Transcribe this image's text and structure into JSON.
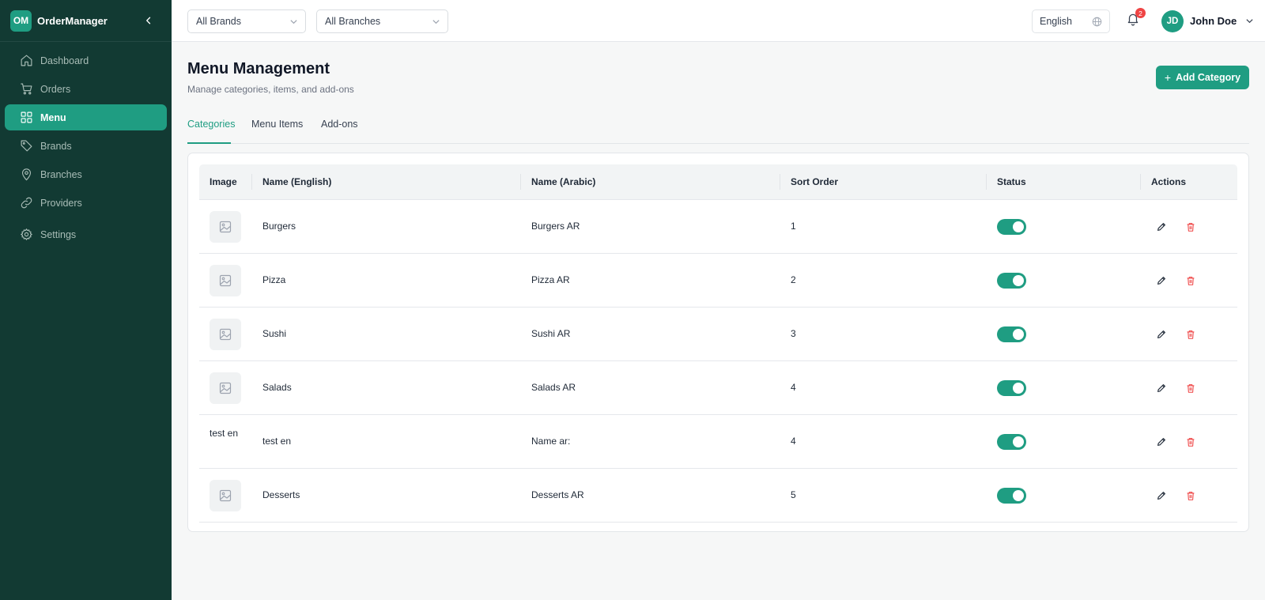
{
  "app": {
    "logo_initials": "OM",
    "name": "OrderManager"
  },
  "sidebar": {
    "items": [
      {
        "label": "Dashboard",
        "icon": "home-icon"
      },
      {
        "label": "Orders",
        "icon": "cart-icon"
      },
      {
        "label": "Menu",
        "icon": "grid-icon",
        "active": true
      },
      {
        "label": "Brands",
        "icon": "tag-icon"
      },
      {
        "label": "Branches",
        "icon": "map-pin-icon"
      },
      {
        "label": "Providers",
        "icon": "link-icon"
      },
      {
        "label": "Settings",
        "icon": "gear-icon"
      }
    ]
  },
  "topbar": {
    "brand_filter": "All Brands",
    "branch_filter": "All Branches",
    "language": "English",
    "notification_count": "2",
    "user_initials": "JD",
    "user_name": "John Doe"
  },
  "page": {
    "title": "Menu Management",
    "subtitle": "Manage categories, items, and add-ons",
    "add_button": "Add Category",
    "tabs": [
      {
        "label": "Categories",
        "active": true
      },
      {
        "label": "Menu Items"
      },
      {
        "label": "Add-ons"
      }
    ]
  },
  "table": {
    "headers": {
      "image": "Image",
      "name_en": "Name (English)",
      "name_ar": "Name (Arabic)",
      "sort": "Sort Order",
      "status": "Status",
      "actions": "Actions"
    },
    "rows": [
      {
        "name_en": "Burgers",
        "name_ar": "Burgers AR",
        "sort": "1",
        "status": true,
        "image": "placeholder"
      },
      {
        "name_en": "Pizza",
        "name_ar": "Pizza AR",
        "sort": "2",
        "status": true,
        "image": "placeholder"
      },
      {
        "name_en": "Sushi",
        "name_ar": "Sushi AR",
        "sort": "3",
        "status": true,
        "image": "placeholder"
      },
      {
        "name_en": "Salads",
        "name_ar": "Salads AR",
        "sort": "4",
        "status": true,
        "image": "placeholder"
      },
      {
        "name_en": "test en",
        "name_ar": "Name ar:",
        "sort": "4",
        "status": true,
        "image": "broken",
        "image_alt": "test en"
      },
      {
        "name_en": "Desserts",
        "name_ar": "Desserts AR",
        "sort": "5",
        "status": true,
        "image": "placeholder"
      }
    ]
  },
  "colors": {
    "sidebar_bg": "#123a33",
    "accent": "#1f9d82",
    "danger": "#ef4444"
  }
}
